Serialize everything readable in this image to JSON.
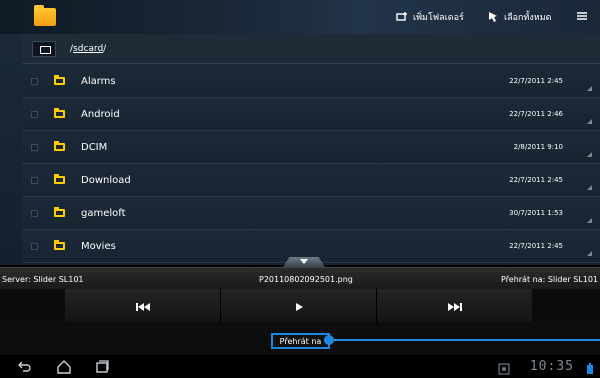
{
  "header": {
    "add_folder_label": "เพิ่มโฟลเดอร์",
    "select_all_label": "เลือกทั้งหมด"
  },
  "path": {
    "prefix": "/",
    "folder": "sdcard",
    "suffix": "/"
  },
  "files": [
    {
      "name": "Alarms",
      "date": "22/7/2011 2:45"
    },
    {
      "name": "Android",
      "date": "22/7/2011 2:46"
    },
    {
      "name": "DCIM",
      "date": "2/8/2011 9:10"
    },
    {
      "name": "Download",
      "date": "22/7/2011 2:45"
    },
    {
      "name": "gameloft",
      "date": "30/7/2011 1:53"
    },
    {
      "name": "Movies",
      "date": "22/7/2011 2:45"
    }
  ],
  "player": {
    "server": "Server: Slider SL101",
    "filename": "P20110802092501.png",
    "play_on": "Přehrát na: Slider SL101",
    "play_to_button": "Přehrát na"
  },
  "status": {
    "time": "10:35"
  },
  "colors": {
    "accent": "#1e88e5",
    "folder": "#ffcc00"
  }
}
